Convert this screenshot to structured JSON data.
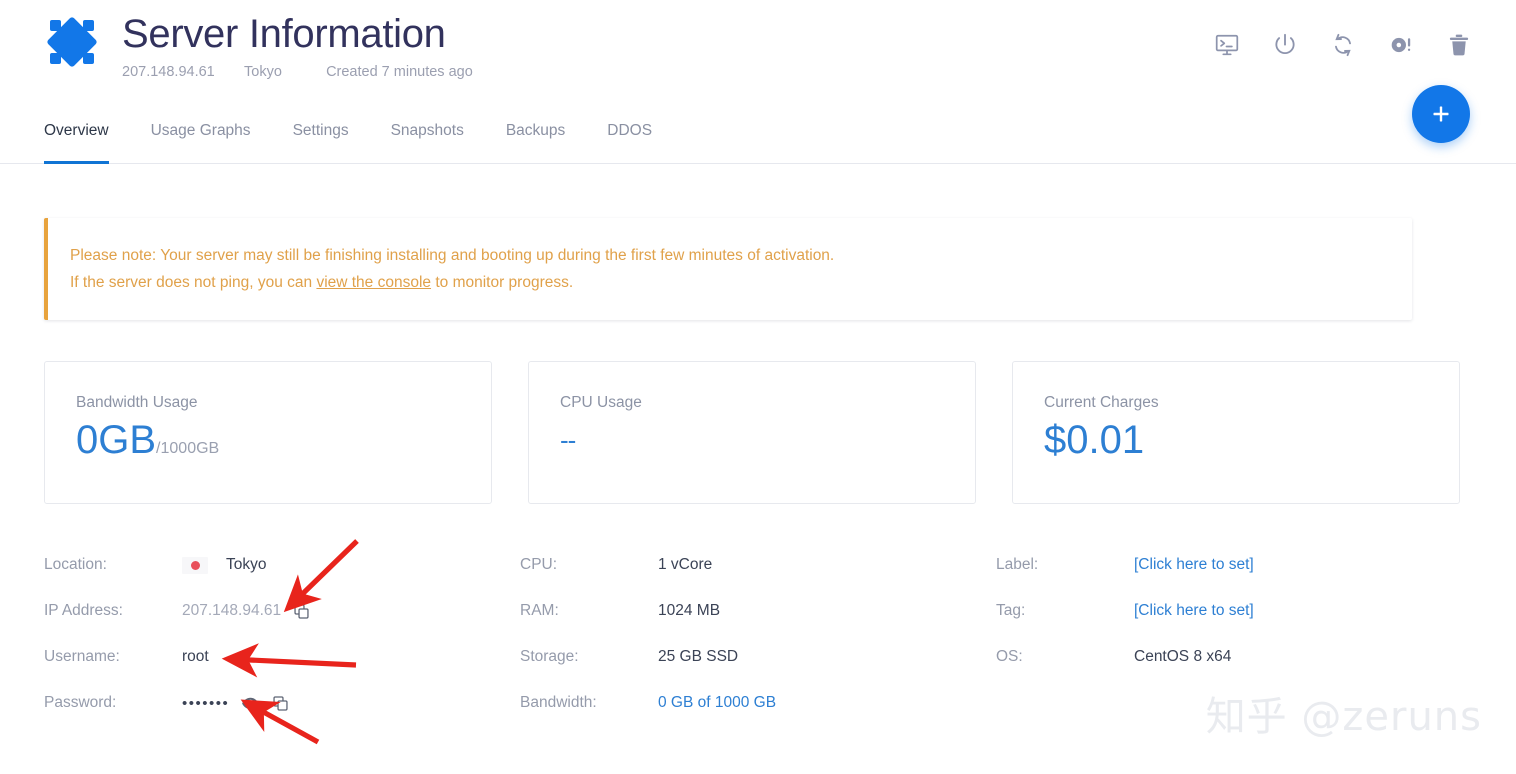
{
  "header": {
    "logo_name": "vultr-logo",
    "title": "Server Information",
    "ip": "207.148.94.61",
    "region": "Tokyo",
    "created": "Created 7 minutes ago",
    "actions": [
      {
        "name": "view-console-icon",
        "label": "View Console"
      },
      {
        "name": "power-icon",
        "label": "Power"
      },
      {
        "name": "restart-icon",
        "label": "Restart"
      },
      {
        "name": "reinstall-icon",
        "label": "Reinstall"
      },
      {
        "name": "delete-icon",
        "label": "Delete"
      }
    ]
  },
  "tabs": [
    {
      "label": "Overview",
      "active": true
    },
    {
      "label": "Usage Graphs",
      "active": false
    },
    {
      "label": "Settings",
      "active": false
    },
    {
      "label": "Snapshots",
      "active": false
    },
    {
      "label": "Backups",
      "active": false
    },
    {
      "label": "DDOS",
      "active": false
    }
  ],
  "fab": {
    "label": "+",
    "name": "deploy-new-server-button"
  },
  "notice": {
    "line1": "Please note: Your server may still be finishing installing and booting up during the first few minutes of activation.",
    "line2_pre": "If the server does not ping, you can ",
    "line2_link": "view the console",
    "line2_post": " to monitor progress.",
    "accent_color": "#e8a33d"
  },
  "cards": [
    {
      "label": "Bandwidth Usage",
      "value": "0GB",
      "suffix": "/1000GB",
      "dash": false
    },
    {
      "label": "CPU Usage",
      "value": "--",
      "suffix": "",
      "dash": true
    },
    {
      "label": "Current Charges",
      "value": "$0.01",
      "suffix": "",
      "dash": false
    }
  ],
  "details": {
    "col1": [
      {
        "key": "Location:",
        "value": "Tokyo",
        "flag": "jp-flag-icon",
        "style": "normal"
      },
      {
        "key": "IP Address:",
        "value": "207.148.94.61",
        "style": "muted",
        "copy": true
      },
      {
        "key": "Username:",
        "value": "root",
        "style": "normal"
      },
      {
        "key": "Password:",
        "value": "•••••••",
        "style": "password",
        "eye": true,
        "copy": true
      }
    ],
    "col2": [
      {
        "key": "CPU:",
        "value": "1 vCore",
        "style": "normal"
      },
      {
        "key": "RAM:",
        "value": "1024 MB",
        "style": "normal"
      },
      {
        "key": "Storage:",
        "value": "25 GB SSD",
        "style": "normal"
      },
      {
        "key": "Bandwidth:",
        "value": "0 GB of 1000 GB",
        "style": "link"
      }
    ],
    "col3": [
      {
        "key": "Label:",
        "value": "[Click here to set]",
        "style": "link"
      },
      {
        "key": "Tag:",
        "value": "[Click here to set]",
        "style": "link"
      },
      {
        "key": "OS:",
        "value": "CentOS 8 x64",
        "style": "normal"
      }
    ]
  },
  "annotations": {
    "arrow_color": "#e8241c",
    "items": [
      {
        "name": "arrow-to-ip-address"
      },
      {
        "name": "arrow-to-username"
      },
      {
        "name": "arrow-to-password-eye"
      }
    ]
  },
  "watermark": {
    "text": "知乎 @zeruns"
  },
  "colors": {
    "primary_blue": "#1277e8",
    "value_blue": "#2d7fd3",
    "notice_orange": "#e0a14a"
  }
}
